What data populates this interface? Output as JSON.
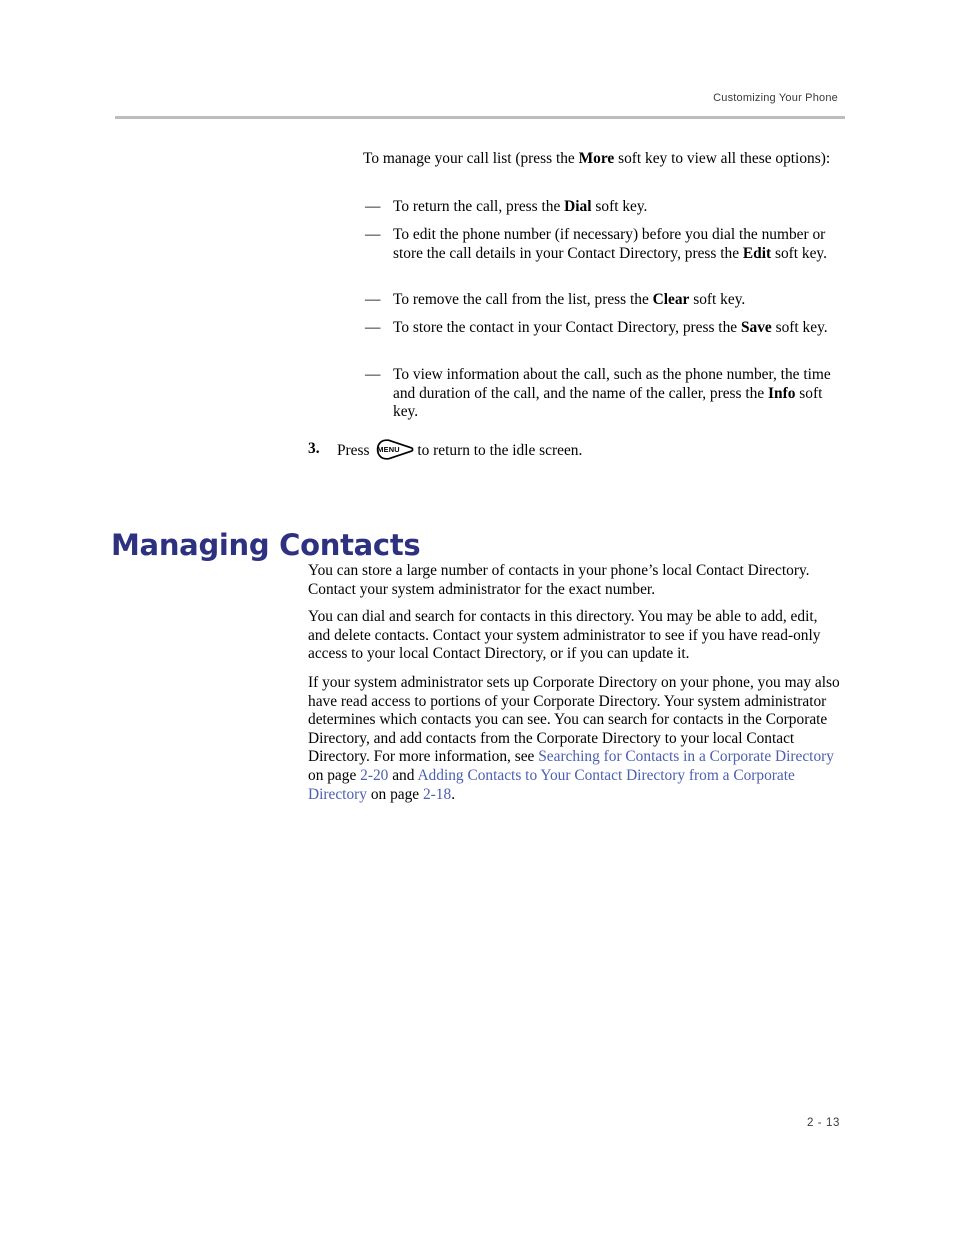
{
  "header": {
    "running_title": "Customizing Your Phone"
  },
  "intro": {
    "lead_part1": "To manage your call list (press the ",
    "lead_bold": "More",
    "lead_part2": " soft key to view all these options):"
  },
  "dash_list": {
    "dash_glyph": "—",
    "items": [
      {
        "before": "To return the call, press the ",
        "bold": "Dial",
        "after": " soft key."
      },
      {
        "before": "To edit the phone number (if necessary) before you dial the number or store the call details in your Contact Directory, press the ",
        "bold": "Edit",
        "after": " soft key."
      },
      {
        "before": "To remove the call from the list, press the ",
        "bold": "Clear",
        "after": " soft key."
      },
      {
        "before": "To store the contact in your Contact Directory, press the ",
        "bold": "Save",
        "after": " soft key."
      },
      {
        "before": "To view information about the call, such as the phone number, the time and duration of the call, and the name of the caller, press the ",
        "bold": "Info",
        "after": " soft key."
      }
    ]
  },
  "step3": {
    "number": "3.",
    "text_before_key": "Press",
    "key_label": "MENU",
    "text_after_key": "to return to the idle screen."
  },
  "section": {
    "heading": "Managing Contacts",
    "paragraph1": "You can store a large number of contacts in your phone’s local Contact Directory. Contact your system administrator for the exact number.",
    "paragraph2": "You can dial and search for contacts in this directory. You may be able to add, edit, and delete contacts. Contact your system administrator to see if you have read-only access to your local Contact Directory, or if you can update it.",
    "paragraph3": {
      "part1": "If your system administrator sets up Corporate Directory on your phone, you may also have read access to portions of your Corporate Directory. Your system administrator determines which contacts you can see. You can search for contacts in the Corporate Directory, and add contacts from the Corporate Directory to your local Contact Directory. For more information, see ",
      "link1": "Searching for Contacts in a Corporate Directory",
      "part2": " on page ",
      "link2": "2-20",
      "part3": " and ",
      "link3": "Adding Contacts to Your Contact Directory from a Corporate Directory",
      "part4": " on page ",
      "link4": "2-18",
      "part5": "."
    }
  },
  "footer": {
    "page_number": "2 - 13"
  },
  "colors": {
    "heading": "#2d3180",
    "link": "#4c5fb0",
    "rule": "#bdbdbd",
    "header_text": "#3a3a3a"
  }
}
